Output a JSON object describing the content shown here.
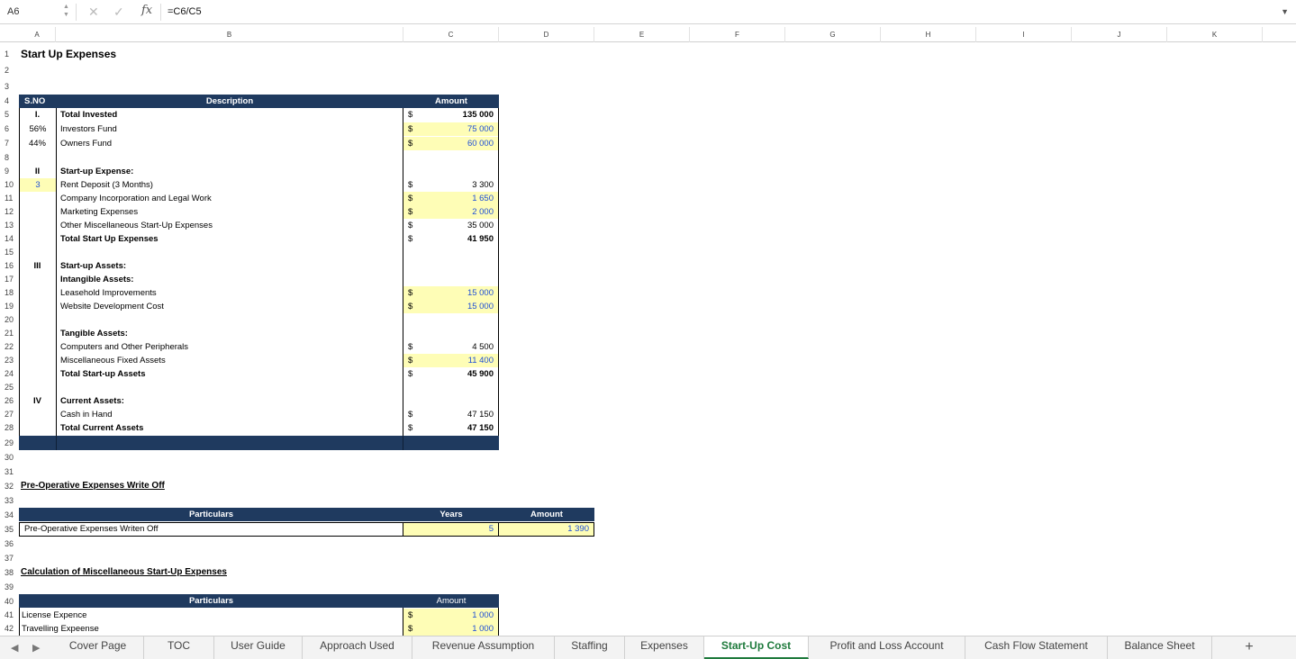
{
  "formula_bar": {
    "cell_ref": "A6",
    "formula": "=C6/C5",
    "fx_label": "fx"
  },
  "columns": [
    "A",
    "B",
    "C",
    "D",
    "E",
    "F",
    "G",
    "H",
    "I",
    "J",
    "K"
  ],
  "rows": [
    "1",
    "2",
    "3",
    "4",
    "5",
    "6",
    "7",
    "8",
    "9",
    "10",
    "11",
    "12",
    "13",
    "14",
    "15",
    "16",
    "17",
    "18",
    "19",
    "20",
    "21",
    "22",
    "23",
    "24",
    "25",
    "26",
    "27",
    "28",
    "29",
    "30",
    "31",
    "32",
    "33",
    "34",
    "35",
    "36",
    "37",
    "38",
    "39",
    "40",
    "41",
    "42"
  ],
  "sheet": {
    "title": "Start Up Expenses",
    "table1": {
      "headers": {
        "sno": "S.NO",
        "description": "Description",
        "amount": "Amount"
      },
      "currency": "$",
      "rows": [
        {
          "sno": "I.",
          "desc": "Total Invested",
          "amount": "135 000"
        },
        {
          "sno": "56%",
          "desc": "Investors Fund",
          "amount": "75 000"
        },
        {
          "sno": "44%",
          "desc": "Owners Fund",
          "amount": "60 000"
        },
        {
          "sno": "II",
          "desc": "Start-up Expense:"
        },
        {
          "sno": "3",
          "desc": "Rent Deposit (3 Months)",
          "amount": "3 300"
        },
        {
          "desc": "Company Incorporation and Legal Work",
          "amount": "1 650"
        },
        {
          "desc": "Marketing Expenses",
          "amount": "2 000"
        },
        {
          "desc": "Other Miscellaneous Start-Up Expenses",
          "amount": "35 000"
        },
        {
          "desc": "Total Start Up Expenses",
          "amount": "41 950"
        },
        {
          "sno": "III",
          "desc": "Start-up Assets:"
        },
        {
          "desc": "Intangible Assets:"
        },
        {
          "desc": "Leasehold Improvements",
          "amount": "15 000"
        },
        {
          "desc": "Website Development Cost",
          "amount": "15 000"
        },
        {
          "desc": "Tangible Assets:"
        },
        {
          "desc": "Computers and Other Peripherals",
          "amount": "4 500"
        },
        {
          "desc": "Miscellaneous Fixed Assets",
          "amount": "11 400"
        },
        {
          "desc": "Total Start-up  Assets",
          "amount": "45 900"
        },
        {
          "sno": "IV",
          "desc": "Current Assets:"
        },
        {
          "desc": "Cash in Hand",
          "amount": "47 150"
        },
        {
          "desc": "Total Current Assets",
          "amount": "47 150"
        }
      ]
    },
    "section2": {
      "title": "Pre-Operative Expenses Write Off",
      "headers": {
        "particulars": "Particulars",
        "years": "Years",
        "amount": "Amount"
      },
      "row": {
        "particulars": "Pre-Operative Expenses Writen Off",
        "years": "5",
        "amount": "1 390"
      }
    },
    "section3": {
      "title": "Calculation of Miscellaneous Start-Up Expenses",
      "headers": {
        "particulars": "Particulars",
        "amount": "Amount"
      },
      "rows": [
        {
          "particulars": "License Expence",
          "amount": "1 000"
        },
        {
          "particulars": "Travelling Expeense",
          "amount": "1 000"
        }
      ]
    }
  },
  "tabs": [
    "Cover Page",
    "TOC",
    "User Guide",
    "Approach Used",
    "Revenue Assumption",
    "Staffing",
    "Expenses",
    "Start-Up Cost",
    "Profit and Loss Account",
    "Cash Flow Statement",
    "Balance Sheet"
  ],
  "active_tab": "Start-Up Cost",
  "colors": {
    "header_navy": "#1f3a5f",
    "input_yellow": "#fefdb6",
    "active_tab_green": "#1e7a3c"
  }
}
